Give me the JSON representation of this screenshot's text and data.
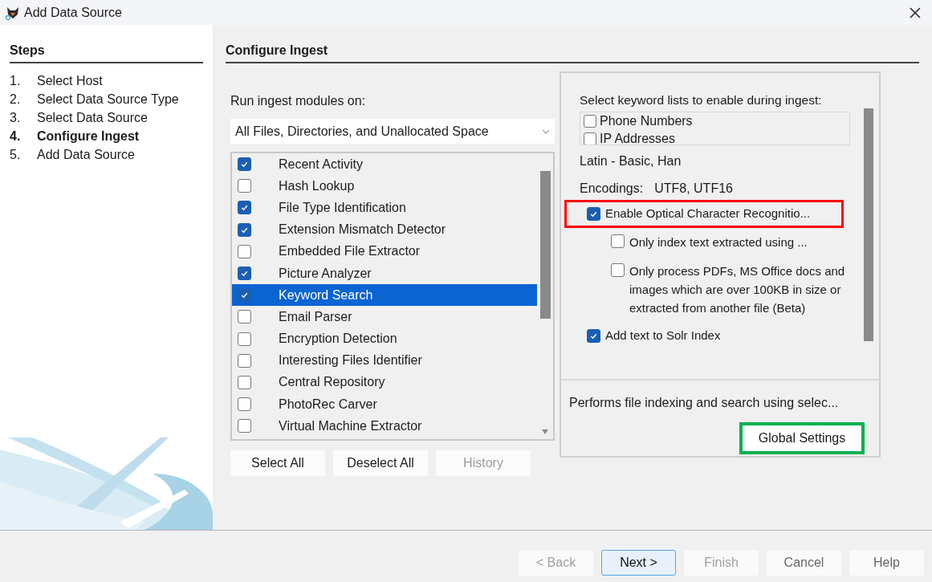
{
  "window": {
    "title": "Add Data Source"
  },
  "steps": {
    "title": "Steps",
    "items": [
      {
        "number": "1.",
        "label": "Select Host",
        "selected": false
      },
      {
        "number": "2.",
        "label": "Select Data Source Type",
        "selected": false
      },
      {
        "number": "3.",
        "label": "Select Data Source",
        "selected": false
      },
      {
        "number": "4.",
        "label": "Configure Ingest",
        "selected": true
      },
      {
        "number": "5.",
        "label": "Add Data Source",
        "selected": false
      }
    ]
  },
  "page_title": "Configure Ingest",
  "run_on": {
    "label": "Run ingest modules on:",
    "value": "All Files, Directories, and Unallocated Space"
  },
  "modules": [
    {
      "label": "Recent Activity",
      "checked": true,
      "selected": false
    },
    {
      "label": "Hash Lookup",
      "checked": false,
      "selected": false
    },
    {
      "label": "File Type Identification",
      "checked": true,
      "selected": false
    },
    {
      "label": "Extension Mismatch Detector",
      "checked": true,
      "selected": false
    },
    {
      "label": "Embedded File Extractor",
      "checked": false,
      "selected": false
    },
    {
      "label": "Picture Analyzer",
      "checked": true,
      "selected": false
    },
    {
      "label": "Keyword Search",
      "checked": true,
      "selected": true
    },
    {
      "label": "Email Parser",
      "checked": false,
      "selected": false
    },
    {
      "label": "Encryption Detection",
      "checked": false,
      "selected": false
    },
    {
      "label": "Interesting Files Identifier",
      "checked": false,
      "selected": false
    },
    {
      "label": "Central Repository",
      "checked": false,
      "selected": false
    },
    {
      "label": "PhotoRec Carver",
      "checked": false,
      "selected": false
    },
    {
      "label": "Virtual Machine Extractor",
      "checked": false,
      "selected": false
    }
  ],
  "module_buttons": [
    {
      "label": "Select All",
      "disabled": false
    },
    {
      "label": "Deselect All",
      "disabled": false
    },
    {
      "label": "History",
      "disabled": true
    }
  ],
  "settings": {
    "keyword_lists_label": "Select keyword lists to enable during ingest:",
    "keyword_lists": [
      {
        "label": "Phone Numbers",
        "checked": false
      },
      {
        "label": "IP Addresses",
        "checked": false
      }
    ],
    "scripts": "Latin - Basic, Han",
    "encodings_label": "Encodings:",
    "encodings": "UTF8, UTF16",
    "options": [
      {
        "label": "Enable Optical Character Recognitio...",
        "checked": true,
        "indented": false,
        "color": "#ff0000"
      },
      {
        "label": "Only index text extracted using ...",
        "checked": false,
        "indented": true
      },
      {
        "label": "Only process PDFs, MS Office docs and images which are over 100KB in size or extracted from another file (Beta)",
        "checked": false,
        "indented": true
      },
      {
        "label": "Add text to Solr Index",
        "checked": true,
        "indented": false
      }
    ],
    "description": "Performs file indexing and search using selec...",
    "global_settings": {
      "label": "Global Settings",
      "color": "#00b050"
    }
  },
  "nav_buttons": [
    {
      "label": "< Back",
      "disabled": true,
      "default": false
    },
    {
      "label": "Next >",
      "disabled": false,
      "default": true
    },
    {
      "label": "Finish",
      "disabled": true,
      "default": false
    },
    {
      "label": "Cancel",
      "disabled": false,
      "default": false
    },
    {
      "label": "Help",
      "disabled": false,
      "default": false
    }
  ]
}
